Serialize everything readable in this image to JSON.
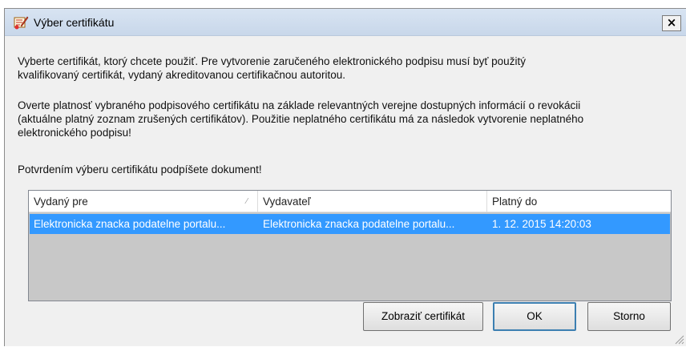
{
  "window": {
    "title": "Výber certifikátu",
    "close_label": "×"
  },
  "message": {
    "paragraph1": [
      "Vyberte certifikát, ktorý chcete použiť. Pre vytvorenie zaručeného elektronického podpisu musí byť použitý",
      "kvalifikovaný certifikát, vydaný akreditovanou certifikačnou autoritou."
    ],
    "paragraph2": [
      "Overte platnosť vybraného podpisového certifikátu na základe relevantných verejne dostupných informácií o revokácii",
      "(aktuálne platný zoznam zrušených certifikátov). Použitie neplatného certifikátu má za následok vytvorenie neplatného",
      "elektronického podpisu!"
    ],
    "paragraph3": "Potvrdením výberu certifikátu podpíšete dokument!"
  },
  "certificates": {
    "columns": [
      "Vydaný pre",
      "Vydavateľ",
      "Platný do"
    ],
    "sort_indicator": "⁄",
    "rows": [
      {
        "issued_to": "Elektronicka znacka podatelne portalu...",
        "issuer": "Elektronicka znacka podatelne portalu...",
        "valid_to": "1. 12. 2015 14:20:03",
        "selected": true
      }
    ]
  },
  "buttons": {
    "view_certificate": "Zobraziť certifikát",
    "ok": "OK",
    "cancel": "Storno"
  },
  "colors": {
    "selection": "#3399ff",
    "dialog_bg": "#f0f0f0",
    "titlebar": "#c8d7ea"
  }
}
